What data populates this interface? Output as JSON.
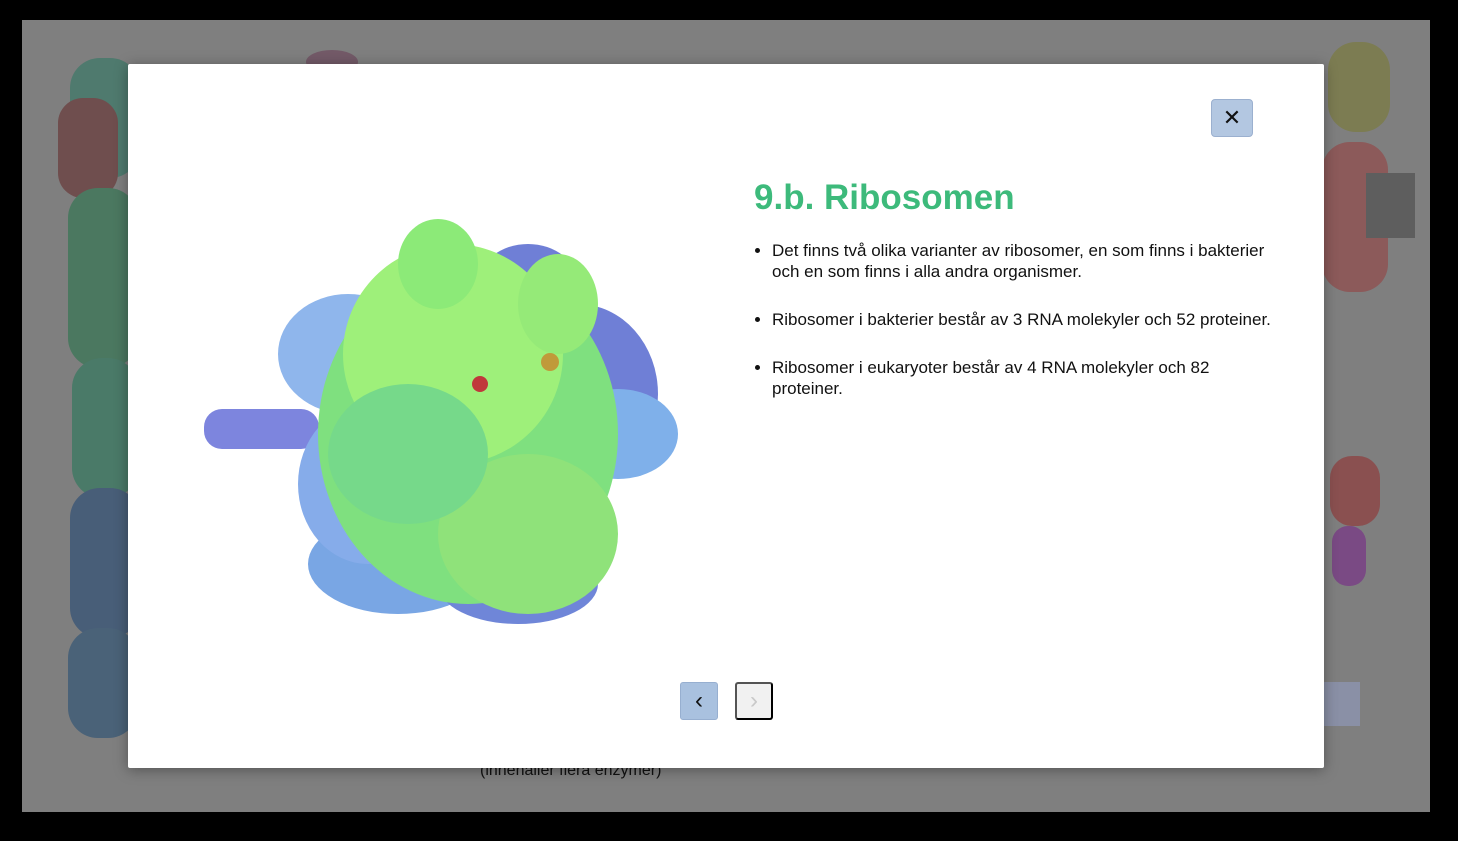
{
  "background": {
    "caption": "(innehåller flera enzymer)"
  },
  "modal": {
    "close_label": "✕",
    "title": "9.b. Ribosomen",
    "bullets": [
      "Det finns två olika varianter av ribosomer, en som finns i bakterier och en som finns i alla andra organismer.",
      "Ribosomer i bakterier består av 3 RNA molekyler och 52 proteiner.",
      "Ribosomer i eukaryoter består av 4 RNA molekyler och 82 proteiner."
    ],
    "nav": {
      "prev_label": "‹",
      "next_label": "›"
    },
    "image_icon": "ribosome-molecular-illustration"
  },
  "colors": {
    "title": "#3dba7b",
    "close_button": "#b3c7e1",
    "prev_button": "#a9c1df",
    "next_button_disabled": "#f1f1f1",
    "overlay": "#7f7f7f"
  }
}
